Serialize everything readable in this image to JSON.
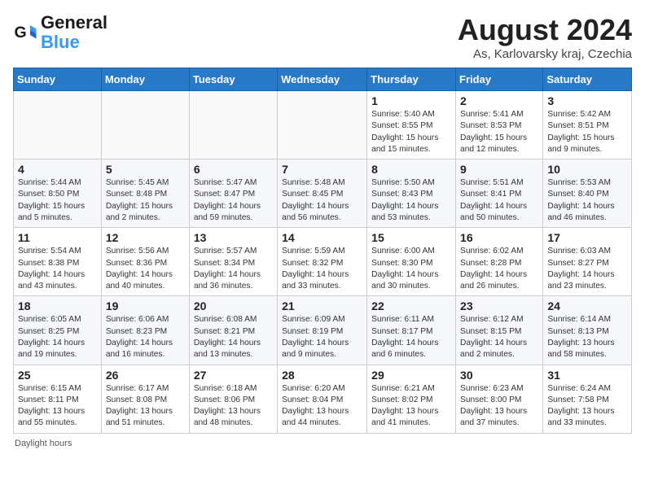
{
  "logo": {
    "line1": "General",
    "line2": "Blue"
  },
  "title": "August 2024",
  "subtitle": "As, Karlovarsky kraj, Czechia",
  "days_of_week": [
    "Sunday",
    "Monday",
    "Tuesday",
    "Wednesday",
    "Thursday",
    "Friday",
    "Saturday"
  ],
  "footer": "Daylight hours",
  "weeks": [
    [
      {
        "num": "",
        "info": ""
      },
      {
        "num": "",
        "info": ""
      },
      {
        "num": "",
        "info": ""
      },
      {
        "num": "",
        "info": ""
      },
      {
        "num": "1",
        "info": "Sunrise: 5:40 AM\nSunset: 8:55 PM\nDaylight: 15 hours and 15 minutes."
      },
      {
        "num": "2",
        "info": "Sunrise: 5:41 AM\nSunset: 8:53 PM\nDaylight: 15 hours and 12 minutes."
      },
      {
        "num": "3",
        "info": "Sunrise: 5:42 AM\nSunset: 8:51 PM\nDaylight: 15 hours and 9 minutes."
      }
    ],
    [
      {
        "num": "4",
        "info": "Sunrise: 5:44 AM\nSunset: 8:50 PM\nDaylight: 15 hours and 5 minutes."
      },
      {
        "num": "5",
        "info": "Sunrise: 5:45 AM\nSunset: 8:48 PM\nDaylight: 15 hours and 2 minutes."
      },
      {
        "num": "6",
        "info": "Sunrise: 5:47 AM\nSunset: 8:47 PM\nDaylight: 14 hours and 59 minutes."
      },
      {
        "num": "7",
        "info": "Sunrise: 5:48 AM\nSunset: 8:45 PM\nDaylight: 14 hours and 56 minutes."
      },
      {
        "num": "8",
        "info": "Sunrise: 5:50 AM\nSunset: 8:43 PM\nDaylight: 14 hours and 53 minutes."
      },
      {
        "num": "9",
        "info": "Sunrise: 5:51 AM\nSunset: 8:41 PM\nDaylight: 14 hours and 50 minutes."
      },
      {
        "num": "10",
        "info": "Sunrise: 5:53 AM\nSunset: 8:40 PM\nDaylight: 14 hours and 46 minutes."
      }
    ],
    [
      {
        "num": "11",
        "info": "Sunrise: 5:54 AM\nSunset: 8:38 PM\nDaylight: 14 hours and 43 minutes."
      },
      {
        "num": "12",
        "info": "Sunrise: 5:56 AM\nSunset: 8:36 PM\nDaylight: 14 hours and 40 minutes."
      },
      {
        "num": "13",
        "info": "Sunrise: 5:57 AM\nSunset: 8:34 PM\nDaylight: 14 hours and 36 minutes."
      },
      {
        "num": "14",
        "info": "Sunrise: 5:59 AM\nSunset: 8:32 PM\nDaylight: 14 hours and 33 minutes."
      },
      {
        "num": "15",
        "info": "Sunrise: 6:00 AM\nSunset: 8:30 PM\nDaylight: 14 hours and 30 minutes."
      },
      {
        "num": "16",
        "info": "Sunrise: 6:02 AM\nSunset: 8:28 PM\nDaylight: 14 hours and 26 minutes."
      },
      {
        "num": "17",
        "info": "Sunrise: 6:03 AM\nSunset: 8:27 PM\nDaylight: 14 hours and 23 minutes."
      }
    ],
    [
      {
        "num": "18",
        "info": "Sunrise: 6:05 AM\nSunset: 8:25 PM\nDaylight: 14 hours and 19 minutes."
      },
      {
        "num": "19",
        "info": "Sunrise: 6:06 AM\nSunset: 8:23 PM\nDaylight: 14 hours and 16 minutes."
      },
      {
        "num": "20",
        "info": "Sunrise: 6:08 AM\nSunset: 8:21 PM\nDaylight: 14 hours and 13 minutes."
      },
      {
        "num": "21",
        "info": "Sunrise: 6:09 AM\nSunset: 8:19 PM\nDaylight: 14 hours and 9 minutes."
      },
      {
        "num": "22",
        "info": "Sunrise: 6:11 AM\nSunset: 8:17 PM\nDaylight: 14 hours and 6 minutes."
      },
      {
        "num": "23",
        "info": "Sunrise: 6:12 AM\nSunset: 8:15 PM\nDaylight: 14 hours and 2 minutes."
      },
      {
        "num": "24",
        "info": "Sunrise: 6:14 AM\nSunset: 8:13 PM\nDaylight: 13 hours and 58 minutes."
      }
    ],
    [
      {
        "num": "25",
        "info": "Sunrise: 6:15 AM\nSunset: 8:11 PM\nDaylight: 13 hours and 55 minutes."
      },
      {
        "num": "26",
        "info": "Sunrise: 6:17 AM\nSunset: 8:08 PM\nDaylight: 13 hours and 51 minutes."
      },
      {
        "num": "27",
        "info": "Sunrise: 6:18 AM\nSunset: 8:06 PM\nDaylight: 13 hours and 48 minutes."
      },
      {
        "num": "28",
        "info": "Sunrise: 6:20 AM\nSunset: 8:04 PM\nDaylight: 13 hours and 44 minutes."
      },
      {
        "num": "29",
        "info": "Sunrise: 6:21 AM\nSunset: 8:02 PM\nDaylight: 13 hours and 41 minutes."
      },
      {
        "num": "30",
        "info": "Sunrise: 6:23 AM\nSunset: 8:00 PM\nDaylight: 13 hours and 37 minutes."
      },
      {
        "num": "31",
        "info": "Sunrise: 6:24 AM\nSunset: 7:58 PM\nDaylight: 13 hours and 33 minutes."
      }
    ]
  ]
}
